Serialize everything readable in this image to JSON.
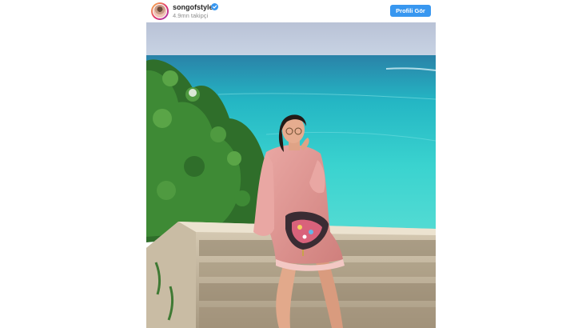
{
  "post": {
    "username": "songofstyle",
    "verified_icon": "verified-badge-icon",
    "followers": "4.9mn takipçi",
    "view_profile_label": "Profili Gör",
    "accent_color": "#3897f0"
  },
  "photo": {
    "icon": "post-photo"
  }
}
